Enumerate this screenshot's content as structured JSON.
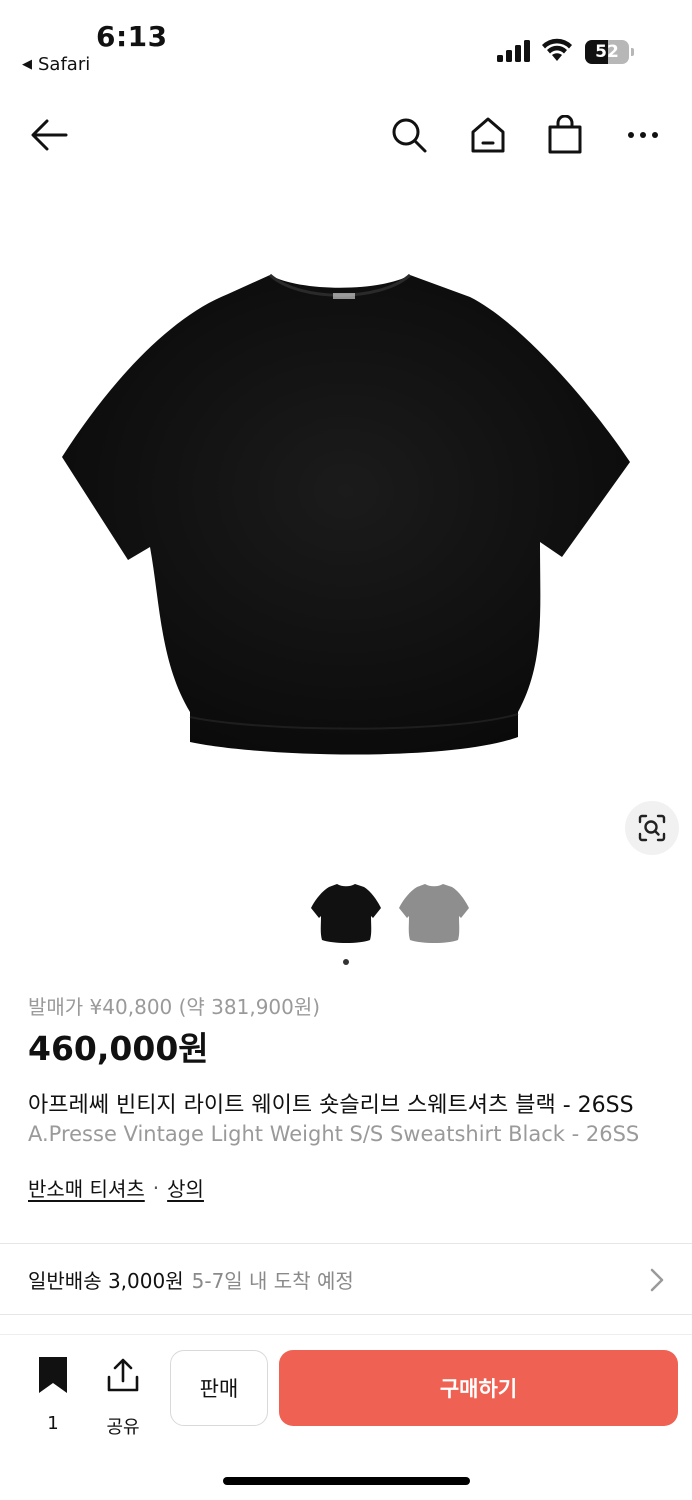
{
  "status_bar": {
    "time": "6:13",
    "back_app": "Safari",
    "battery_level": "52",
    "battery_fraction": 0.52
  },
  "nav": {
    "icons": [
      "back-arrow-icon",
      "search-icon",
      "home-icon",
      "shopping-bag-icon",
      "more-icon"
    ]
  },
  "product": {
    "release_price": "발매가 ¥40,800 (약 381,900원)",
    "price": "460,000원",
    "title_ko": "아프레쎄 빈티지 라이트 웨이트 숏슬리브 스웨트셔츠 블랙 - 26SS",
    "title_en": "A.Presse Vintage Light Weight S/S Sweatshirt Black - 26SS",
    "categories": [
      "반소매 티셔츠",
      "상의"
    ],
    "category_separator": "·",
    "gallery": {
      "image_count": 2,
      "active_index": 0,
      "thumbnail_colors": [
        "#111111",
        "#8e8e8e"
      ]
    }
  },
  "shipping": {
    "fee": "일반배송 3,000원",
    "eta": "5-7일 내 도착 예정"
  },
  "bottom_bar": {
    "bookmark_count": "1",
    "share_label": "공유",
    "sell_label": "판매",
    "buy_label": "구매하기"
  },
  "colors": {
    "accent": "#ef6253",
    "text": "#111111",
    "muted": "#9a9a9a"
  }
}
